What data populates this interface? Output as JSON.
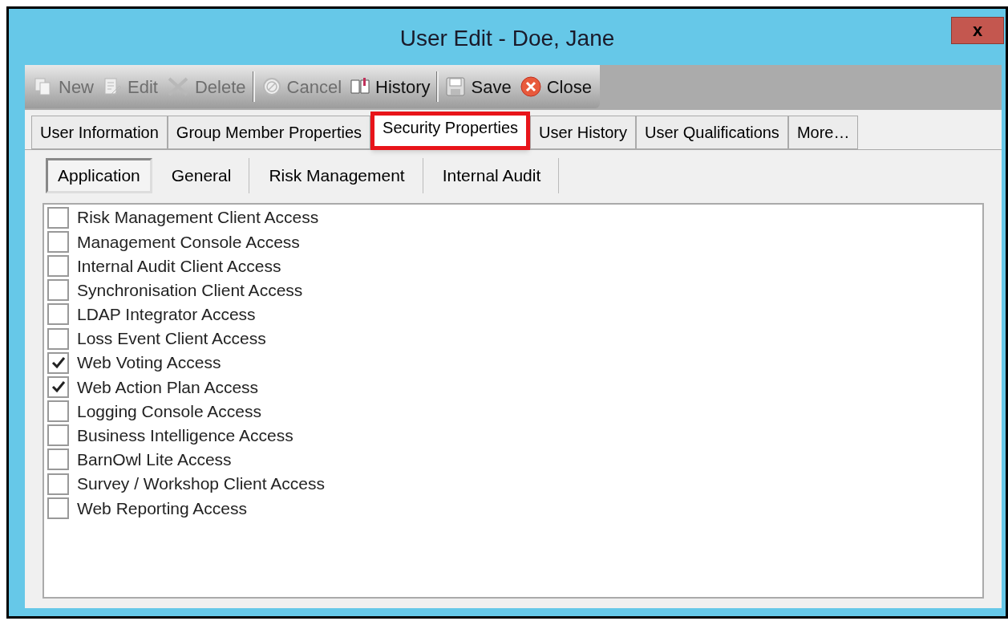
{
  "window": {
    "title": "User Edit - Doe, Jane",
    "close_label": "x"
  },
  "toolbar": [
    {
      "label": "New",
      "kind": "new",
      "disabled": true,
      "separator_after": false
    },
    {
      "label": "Edit",
      "kind": "edit",
      "disabled": true,
      "separator_after": false
    },
    {
      "label": "Delete",
      "kind": "delete",
      "disabled": true,
      "separator_after": true
    },
    {
      "label": "Cancel",
      "kind": "cancel",
      "disabled": true,
      "separator_after": false
    },
    {
      "label": "History",
      "kind": "history",
      "disabled": false,
      "separator_after": true
    },
    {
      "label": "Save",
      "kind": "save",
      "disabled": false,
      "separator_after": false
    },
    {
      "label": "Close",
      "kind": "close",
      "disabled": false,
      "separator_after": false
    }
  ],
  "tabs": [
    {
      "label": "User Information",
      "selected": false,
      "highlighted": false
    },
    {
      "label": "Group Member Properties",
      "selected": false,
      "highlighted": false
    },
    {
      "label": "Security Properties",
      "selected": true,
      "highlighted": true
    },
    {
      "label": "User History",
      "selected": false,
      "highlighted": false
    },
    {
      "label": "User Qualifications",
      "selected": false,
      "highlighted": false
    },
    {
      "label": "More…",
      "selected": false,
      "highlighted": false
    }
  ],
  "subtabs": [
    {
      "label": "Application",
      "selected": true
    },
    {
      "label": "General",
      "selected": false
    },
    {
      "label": "Risk Management",
      "selected": false
    },
    {
      "label": "Internal Audit",
      "selected": false
    }
  ],
  "permissions": [
    {
      "label": "Risk Management Client Access",
      "checked": false
    },
    {
      "label": "Management Console Access",
      "checked": false
    },
    {
      "label": "Internal Audit Client Access",
      "checked": false
    },
    {
      "label": "Synchronisation Client Access",
      "checked": false
    },
    {
      "label": "LDAP Integrator Access",
      "checked": false
    },
    {
      "label": "Loss Event Client Access",
      "checked": false
    },
    {
      "label": "Web Voting Access",
      "checked": true
    },
    {
      "label": "Web Action Plan Access",
      "checked": true
    },
    {
      "label": "Logging Console Access",
      "checked": false
    },
    {
      "label": "Business Intelligence Access",
      "checked": false
    },
    {
      "label": "BarnOwl Lite Access",
      "checked": false
    },
    {
      "label": "Survey / Workshop Client Access",
      "checked": false
    },
    {
      "label": "Web Reporting Access",
      "checked": false
    }
  ]
}
